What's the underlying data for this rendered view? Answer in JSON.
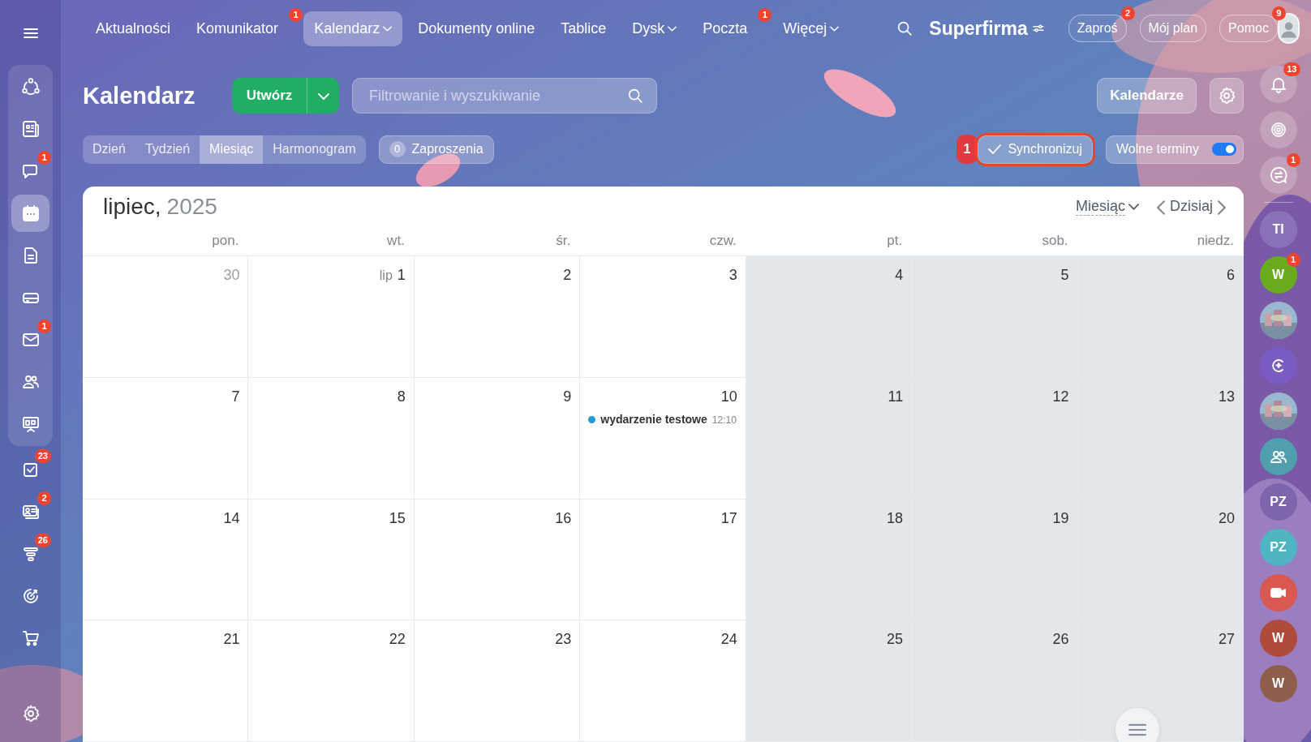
{
  "nav": [
    {
      "label": "Aktualności",
      "selected": false,
      "dropdown": false
    },
    {
      "label": "Komunikator",
      "selected": false,
      "dropdown": false,
      "badge": "1"
    },
    {
      "label": "Kalendarz",
      "selected": true,
      "dropdown": true
    },
    {
      "label": "Dokumenty online",
      "selected": false,
      "dropdown": false
    },
    {
      "label": "Tablice",
      "selected": false,
      "dropdown": false
    },
    {
      "label": "Dysk",
      "selected": false,
      "dropdown": true
    },
    {
      "label": "Poczta",
      "selected": false,
      "dropdown": false,
      "badge": "1"
    },
    {
      "label": "Więcej",
      "selected": false,
      "dropdown": true
    }
  ],
  "company": {
    "name": "Superfirma"
  },
  "header_buttons": [
    {
      "label": "Zaproś",
      "badge": "2"
    },
    {
      "label": "Mój plan"
    },
    {
      "label": "Pomoc",
      "badge": "9"
    }
  ],
  "sidebar": {
    "pinned": [
      {
        "kind": "hub",
        "selected": false
      },
      {
        "kind": "news",
        "selected": false
      },
      {
        "kind": "chat",
        "selected": false,
        "badge": "1"
      },
      {
        "kind": "calendar",
        "selected": true
      },
      {
        "kind": "document",
        "selected": false
      },
      {
        "kind": "drive",
        "selected": false
      },
      {
        "kind": "mail",
        "selected": false,
        "badge": "1"
      },
      {
        "kind": "people",
        "selected": false
      },
      {
        "kind": "board",
        "selected": false
      }
    ],
    "items": [
      {
        "kind": "tasks",
        "selected": false,
        "badge": "23"
      },
      {
        "kind": "card",
        "selected": false,
        "badge": "2"
      },
      {
        "kind": "funnel",
        "selected": false,
        "badge": "26"
      },
      {
        "kind": "target",
        "selected": false
      },
      {
        "kind": "cart",
        "selected": false
      }
    ]
  },
  "page": {
    "title": "Kalendarz",
    "create_button": "Utwórz",
    "filter": {
      "placeholder": "Filtrowanie i wyszukiwanie"
    },
    "calendars_button": "Kalendarze"
  },
  "view_tabs": [
    {
      "label": "Dzień",
      "selected": false
    },
    {
      "label": "Tydzień",
      "selected": false
    },
    {
      "label": "Miesiąc",
      "selected": true
    },
    {
      "label": "Harmonogram",
      "selected": false
    }
  ],
  "invitations": {
    "count": "0",
    "label": "Zaproszenia"
  },
  "sync": {
    "step": "1",
    "label": "Synchronizuj",
    "highlighted": true
  },
  "free_slots": {
    "label": "Wolne terminy",
    "on": true
  },
  "calendar": {
    "month": "lipiec,",
    "year": "2025",
    "view_select": "Miesiąc",
    "today": "Dzisiaj",
    "weekdays": [
      {
        "label": "pon.",
        "off": false
      },
      {
        "label": "wt.",
        "off": false
      },
      {
        "label": "śr.",
        "off": false
      },
      {
        "label": "czw.",
        "off": false
      },
      {
        "label": "pt.",
        "off": true
      },
      {
        "label": "sob.",
        "off": true
      },
      {
        "label": "niedz.",
        "off": true
      }
    ],
    "weeks": [
      [
        {
          "day": "30",
          "other_month": true
        },
        {
          "day": "1",
          "prefix": "lip",
          "other_month": false
        },
        {
          "day": "2",
          "other_month": false
        },
        {
          "day": "3",
          "other_month": false
        },
        {
          "day": "4",
          "other_month": false
        },
        {
          "day": "5",
          "other_month": false
        },
        {
          "day": "6",
          "other_month": false
        }
      ],
      [
        {
          "day": "7",
          "other_month": false
        },
        {
          "day": "8",
          "other_month": false
        },
        {
          "day": "9",
          "other_month": false
        },
        {
          "day": "10",
          "other_month": false,
          "events": [
            {
              "title": "wydarzenie testowe",
              "time": "12:10",
              "color": "#1e9bd7"
            }
          ]
        },
        {
          "day": "11",
          "other_month": false
        },
        {
          "day": "12",
          "other_month": false
        },
        {
          "day": "13",
          "other_month": false
        }
      ],
      [
        {
          "day": "14",
          "other_month": false
        },
        {
          "day": "15",
          "other_month": false
        },
        {
          "day": "16",
          "other_month": false
        },
        {
          "day": "17",
          "other_month": false
        },
        {
          "day": "18",
          "other_month": false
        },
        {
          "day": "19",
          "other_month": false
        },
        {
          "day": "20",
          "other_month": false
        }
      ],
      [
        {
          "day": "21",
          "other_month": false
        },
        {
          "day": "22",
          "other_month": false
        },
        {
          "day": "23",
          "other_month": false
        },
        {
          "day": "24",
          "other_month": false
        },
        {
          "day": "25",
          "other_month": false
        },
        {
          "day": "26",
          "other_month": false
        },
        {
          "day": "27",
          "other_month": false
        }
      ]
    ]
  },
  "right_bar": [
    {
      "kind": "bell",
      "badge": "13"
    },
    {
      "kind": "orbit"
    },
    {
      "kind": "swap",
      "badge": "1"
    },
    {
      "kind": "avatar",
      "initials": "TI",
      "color": "#8a72b8"
    },
    {
      "kind": "avatar",
      "initials": "W",
      "color": "#6aab1e",
      "badge": "1"
    },
    {
      "kind": "picture"
    },
    {
      "kind": "logo",
      "color": "#7b5bc4"
    },
    {
      "kind": "picture"
    },
    {
      "kind": "people",
      "color": "#4f9fae"
    },
    {
      "kind": "avatar",
      "initials": "PZ",
      "color": "#7e63ad"
    },
    {
      "kind": "avatar",
      "initials": "PZ",
      "color": "#4fb5c2"
    },
    {
      "kind": "video",
      "color": "#d9584f"
    },
    {
      "kind": "avatar",
      "initials": "W",
      "color": "#b04a3a"
    },
    {
      "kind": "avatar",
      "initials": "W",
      "color": "#8e5e4a"
    }
  ]
}
